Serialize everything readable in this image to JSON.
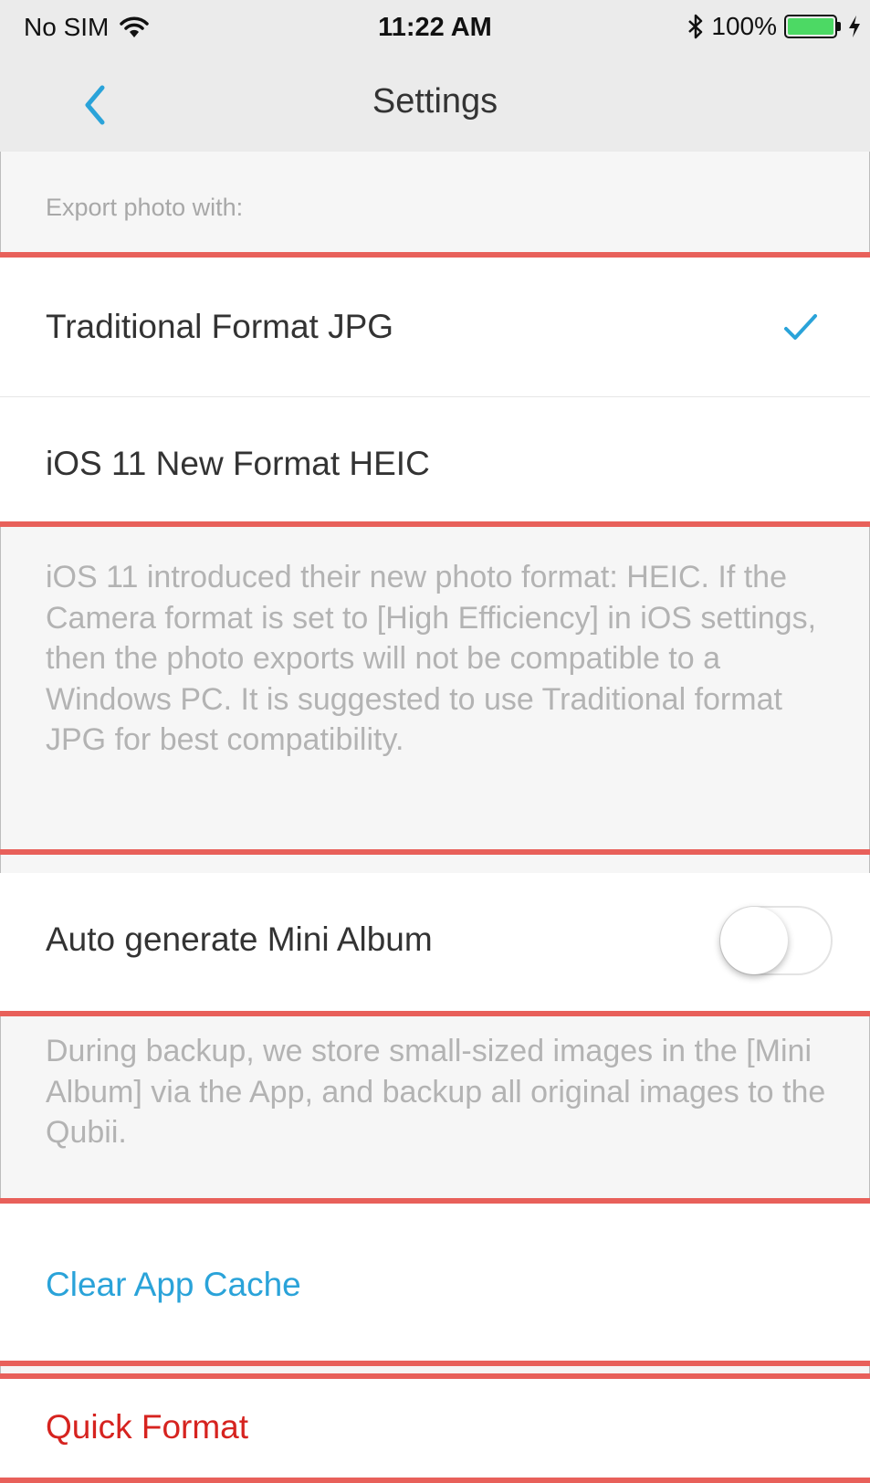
{
  "status_bar": {
    "carrier": "No SIM",
    "time": "11:22 AM",
    "battery": "100%",
    "wifi_icon": "wifi-icon",
    "bluetooth_icon": "bluetooth-icon",
    "charging_icon": "charging-bolt-icon",
    "battery_level": 1.0
  },
  "navbar": {
    "title": "Settings",
    "back_icon": "chevron-left-icon"
  },
  "export_section": {
    "header": "Export photo with:",
    "options": [
      {
        "label": "Traditional Format JPG",
        "selected": true
      },
      {
        "label": "iOS 11 New Format HEIC",
        "selected": false
      }
    ],
    "footer": "iOS 11 introduced their new photo format: HEIC. If the Camera format is set to [High Efficiency] in iOS settings, then the photo exports will not be compatible to a Windows PC. It is suggested to use Traditional format JPG for best compatibility."
  },
  "mini_album": {
    "label": "Auto generate Mini Album",
    "enabled": false,
    "footer": "During backup, we store small-sized images in the [Mini Album] via the App, and backup all original images to the Qubii."
  },
  "actions": {
    "clear_cache": "Clear App Cache",
    "quick_format": "Quick Format"
  },
  "colors": {
    "accent_blue": "#2aa3d9",
    "destructive_red": "#d6231f",
    "highlight_red": "#e8605a"
  }
}
